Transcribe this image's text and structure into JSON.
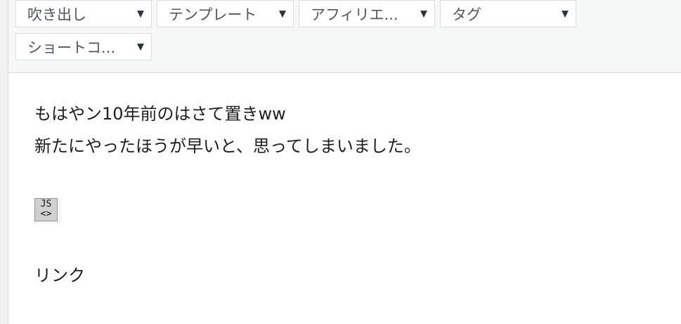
{
  "toolbar": {
    "dropdowns": [
      {
        "label": "吹き出し"
      },
      {
        "label": "テンプレート"
      },
      {
        "label": "アフィリエ..."
      },
      {
        "label": "タグ"
      },
      {
        "label": "ショートコ..."
      }
    ],
    "caret_glyph": "▼"
  },
  "editor": {
    "line1": "もはやン10年前のはさて置きww",
    "line2": "新たにやったほうが早いと、思ってしまいました。",
    "js_block": {
      "label": "JS",
      "icon": "<>",
      "icon_name": "code-icon"
    },
    "link_text": "リンク"
  }
}
